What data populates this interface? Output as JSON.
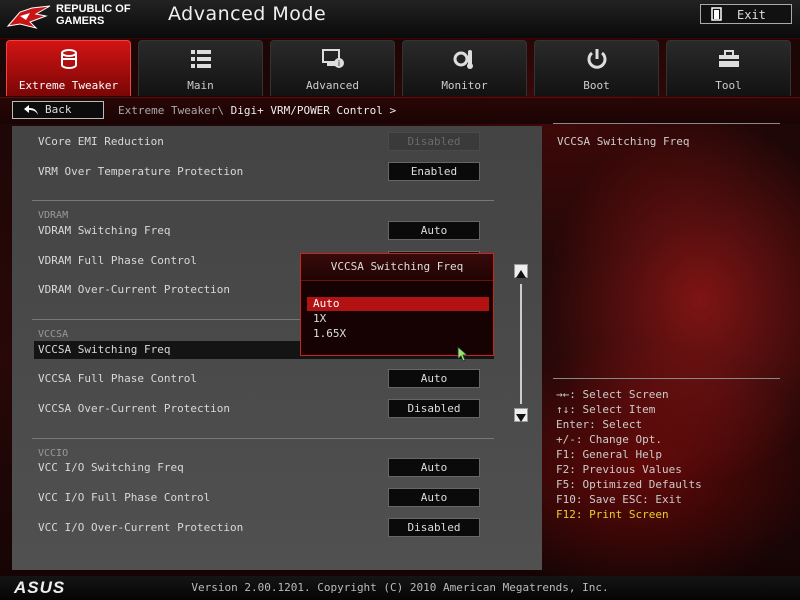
{
  "header": {
    "brand_line1": "REPUBLIC OF",
    "brand_line2": "GAMERS",
    "mode": "Advanced Mode",
    "exit_label": "Exit"
  },
  "tabs": [
    {
      "label": "Extreme Tweaker",
      "icon": "tweaker-icon",
      "active": true
    },
    {
      "label": "Main",
      "icon": "list-icon",
      "active": false
    },
    {
      "label": "Advanced",
      "icon": "advanced-icon",
      "active": false
    },
    {
      "label": "Monitor",
      "icon": "monitor-icon",
      "active": false
    },
    {
      "label": "Boot",
      "icon": "power-icon",
      "active": false
    },
    {
      "label": "Tool",
      "icon": "toolbox-icon",
      "active": false
    }
  ],
  "breadcrumb": {
    "back_label": "Back",
    "path_prefix": "Extreme Tweaker\\",
    "path_current": "Digi+ VRM/POWER Control >"
  },
  "settings": {
    "vcore_emi_label": "VCore EMI Reduction",
    "vcore_emi_value": "Disabled",
    "vrm_temp_label": "VRM Over Temperature Protection",
    "vrm_temp_value": "Enabled",
    "vdram_section": "VDRAM",
    "vdram_freq_label": "VDRAM Switching Freq",
    "vdram_freq_value": "Auto",
    "vdram_phase_label": "VDRAM Full Phase Control",
    "vdram_ocp_label": "VDRAM Over-Current Protection",
    "vccsa_section": "VCCSA",
    "vccsa_freq_label": "VCCSA Switching Freq",
    "vccsa_phase_label": "VCCSA Full Phase Control",
    "vccsa_phase_value": "Auto",
    "vccsa_ocp_label": "VCCSA Over-Current Protection",
    "vccsa_ocp_value": "Disabled",
    "vccio_section": "VCCIO",
    "vccio_freq_label": "VCC I/O Switching Freq",
    "vccio_freq_value": "Auto",
    "vccio_phase_label": "VCC I/O Full Phase Control",
    "vccio_phase_value": "Auto",
    "vccio_ocp_label": "VCC I/O Over-Current Protection",
    "vccio_ocp_value": "Disabled"
  },
  "popup": {
    "title": "VCCSA Switching Freq",
    "options": [
      "Auto",
      "1X",
      "1.65X"
    ],
    "selected": "Auto"
  },
  "help": {
    "title": "VCCSA Switching Freq",
    "keys": [
      "→←: Select Screen",
      "↑↓: Select Item",
      "Enter: Select",
      "+/-: Change Opt.",
      "F1: General Help",
      "F2: Previous Values",
      "F5: Optimized Defaults",
      "F10: Save  ESC: Exit",
      "F12: Print Screen"
    ]
  },
  "footer": {
    "brand": "ASUS",
    "version": "Version 2.00.1201. Copyright (C) 2010 American Megatrends, Inc."
  },
  "colors": {
    "accent": "#c41414",
    "highlight_key": "#e8d02a"
  }
}
